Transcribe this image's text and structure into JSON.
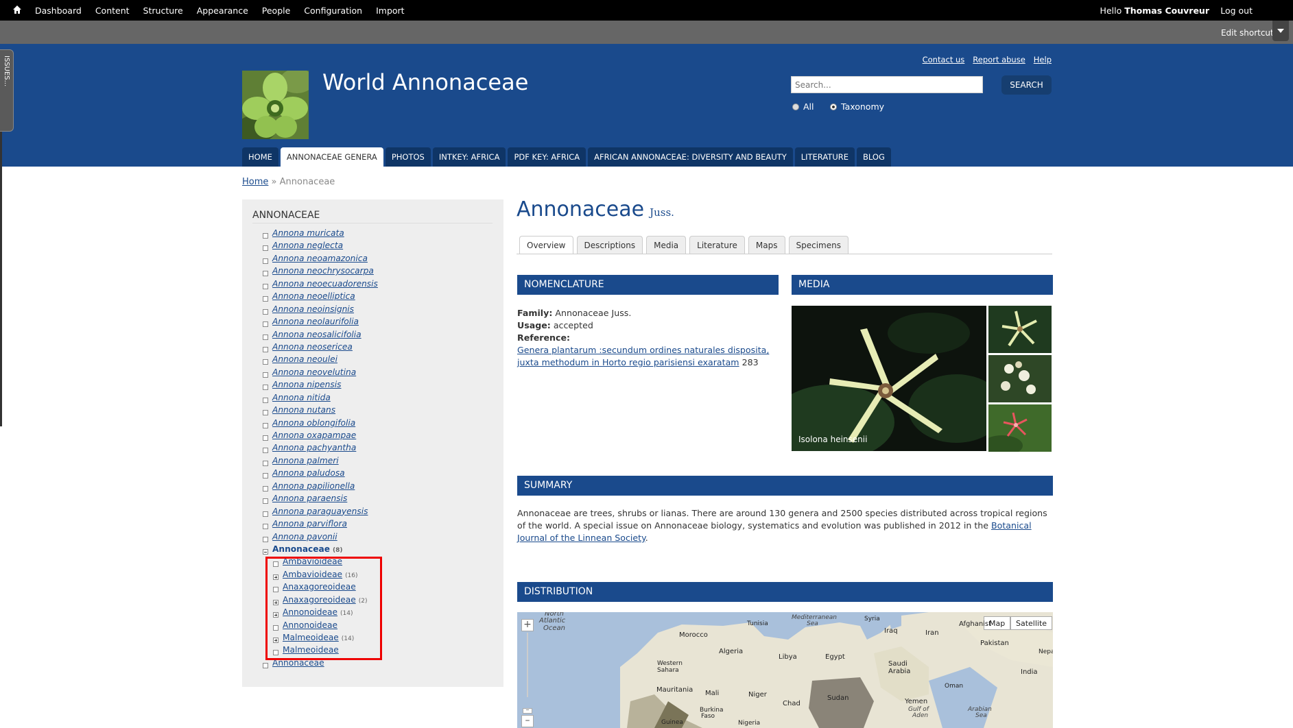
{
  "toolbar": {
    "menu": [
      "Dashboard",
      "Content",
      "Structure",
      "Appearance",
      "People",
      "Configuration",
      "Import"
    ],
    "hello": "Hello",
    "user_name": "Thomas Couvreur",
    "logout": "Log out",
    "edit_shortcuts": "Edit shortcuts"
  },
  "issues_tab": "ISSUES...",
  "header": {
    "site_name": "World Annonaceae",
    "links": [
      "Contact us",
      "Report abuse",
      "Help"
    ],
    "search_placeholder": "Search...",
    "search_button": "SEARCH",
    "radio_all": "All",
    "radio_taxonomy": "Taxonomy",
    "nav": [
      "HOME",
      "ANNONACEAE GENERA",
      "PHOTOS",
      "INTKEY: AFRICA",
      "PDF KEY: AFRICA",
      "AFRICAN ANNONACEAE: DIVERSITY AND BEAUTY",
      "LITERATURE",
      "BLOG"
    ],
    "nav_active": "ANNONACEAE GENERA"
  },
  "breadcrumb": {
    "home": "Home",
    "sep": "»",
    "current": "Annonaceae"
  },
  "sidebar": {
    "title": "ANNONACEAE",
    "species": [
      "Annona muricata",
      "Annona neglecta",
      "Annona neoamazonica",
      "Annona neochrysocarpa",
      "Annona neoecuadorensis",
      "Annona neoelliptica",
      "Annona neoinsignis",
      "Annona neolaurifolia",
      "Annona neosalicifolia",
      "Annona neosericea",
      "Annona neoulei",
      "Annona neovelutina",
      "Annona nipensis",
      "Annona nitida",
      "Annona nutans",
      "Annona oblongifolia",
      "Annona oxapampae",
      "Annona pachyantha",
      "Annona palmeri",
      "Annona paludosa",
      "Annona papilionella",
      "Annona paraensis",
      "Annona paraguayensis",
      "Annona parviflora",
      "Annona pavonii"
    ],
    "expanded": {
      "label": "Annonaceae",
      "count": "(8)"
    },
    "children": [
      {
        "label": "Ambavioideae",
        "count": ""
      },
      {
        "label": "Ambavioideae",
        "count": "(16)"
      },
      {
        "label": "Anaxagoreoideae",
        "count": ""
      },
      {
        "label": "Anaxagoreoideae",
        "count": "(2)"
      },
      {
        "label": "Annonoideae",
        "count": "(14)"
      },
      {
        "label": "Annonoideae",
        "count": ""
      },
      {
        "label": "Malmeoideae",
        "count": "(14)"
      },
      {
        "label": "Malmeoideae",
        "count": ""
      }
    ],
    "last": "Annonaceae"
  },
  "main": {
    "title": "Annonaceae",
    "author": "Juss.",
    "tabs": [
      "Overview",
      "Descriptions",
      "Media",
      "Literature",
      "Maps",
      "Specimens"
    ],
    "active_tab": "Overview",
    "nomenclature": {
      "heading": "NOMENCLATURE",
      "family_label": "Family:",
      "family_value": "Annonaceae Juss.",
      "usage_label": "Usage:",
      "usage_value": "accepted",
      "reference_label": "Reference:",
      "reference_link": "Genera plantarum :secundum ordines naturales disposita, juxta methodum in Horto regio parisiensi exaratam",
      "reference_page": "283"
    },
    "media": {
      "heading": "MEDIA",
      "caption": "Isolona heinsenii"
    },
    "summary": {
      "heading": "SUMMARY",
      "text": "Annonaceae are trees, shrubs or lianas. There are around 130 genera and 2500 species distributed across tropical regions of the world. A special issue on Annonaceae biology, systematics and evolution was published in 2012 in the",
      "link": "Botanical Journal of the Linnean Society",
      "end": "."
    },
    "distribution": {
      "heading": "DISTRIBUTION",
      "map_button": "Map",
      "satellite_button": "Satellite",
      "labels": [
        "North",
        "Atlantic",
        "Ocean",
        "Morocco",
        "Tunisia",
        "Mediterranean",
        "Sea",
        "Syria",
        "Iraq",
        "Iran",
        "Afghanist",
        "Pakistan",
        "Nepa",
        "Algeria",
        "Libya",
        "Egypt",
        "Western",
        "Sahara",
        "Saudi",
        "Arabia",
        "India",
        "Oman",
        "Mauritania",
        "Mali",
        "Niger",
        "Chad",
        "Sudan",
        "Yemen",
        "Gulf of",
        "Aden",
        "Arabian",
        "Sea",
        "Burkina",
        "Faso",
        "Guinea",
        "Nigeria"
      ]
    }
  },
  "colors": {
    "brand_blue": "#1a4a8c",
    "highlight": "#ee0000"
  }
}
